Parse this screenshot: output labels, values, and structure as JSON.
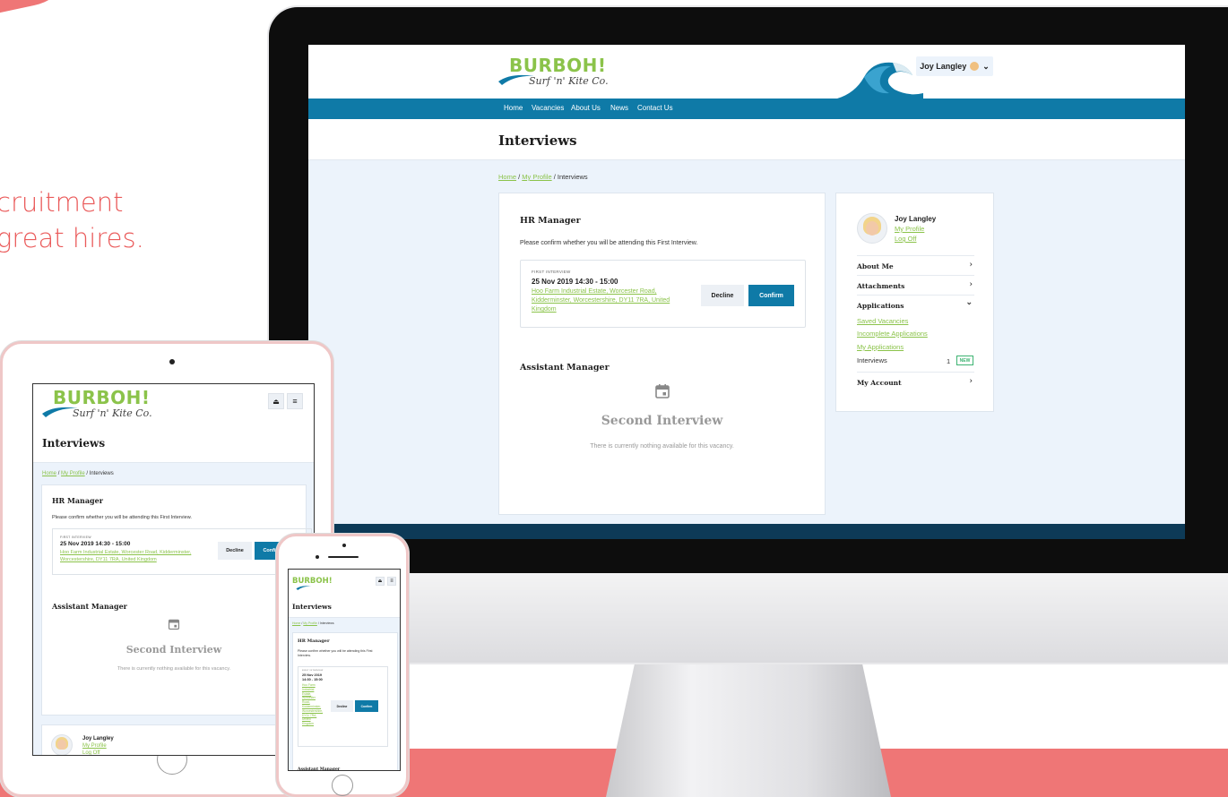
{
  "marketing": {
    "tagline_line1": "cruitment",
    "tagline_line2": "great hires.",
    "accent_color": "#ef7676"
  },
  "brand": {
    "logo_text": "BURBOH!",
    "logo_sub": "Surf 'n' Kite Co.",
    "primary_color": "#0f7aa7",
    "accent_color": "#8bc34a"
  },
  "header": {
    "user_name": "Joy Langley",
    "user_menu_icon": "chevron-down-icon"
  },
  "nav": [
    "Home",
    "Vacancies",
    "About Us",
    "News",
    "Contact Us"
  ],
  "page": {
    "title": "Interviews",
    "breadcrumb": {
      "home": "Home",
      "sep": "/",
      "profile": "My Profile",
      "current": "Interviews"
    }
  },
  "interviews": {
    "hr": {
      "title": "HR Manager",
      "prompt": "Please confirm whether you will be attending this First Interview.",
      "label": "FIRST INTERVIEW",
      "date": "25 Nov 2019 14:30 - 15:00",
      "address": "Hoo Farm Industrial Estate, Worcester Road, Kidderminster, Worcestershire, DY11 7RA, United Kingdom",
      "decline": "Decline",
      "confirm": "Confirm"
    },
    "assistant": {
      "title": "Assistant Manager",
      "empty_title": "Second Interview",
      "empty_text": "There is currently nothing available for this vacancy."
    }
  },
  "sidebar": {
    "name": "Joy Langley",
    "my_profile": "My Profile",
    "log_off": "Log Off",
    "about_me": "About Me",
    "attachments": "Attachments",
    "applications": "Applications",
    "saved_vacancies": "Saved Vacancies",
    "incomplete_applications": "Incomplete Applications",
    "my_applications": "My Applications",
    "interviews": "Interviews",
    "interviews_count": "1",
    "new_badge": "NEW",
    "my_account": "My Account",
    "chevron_right": "›",
    "chevron_down": "⌄"
  },
  "iphone": {
    "date_line1": "25 Nov 2019",
    "date_line2": "14:30 - 15:00",
    "addr_lines": [
      "Hoo Farm",
      "Industrial",
      "Estate,",
      "Worcester",
      "Road,",
      "Kidderminster,",
      "Worcestershire,",
      "DY11 7RA,",
      "United",
      "Kingdom"
    ],
    "prompt_line1": "Please confirm whether you will be attending this First",
    "prompt_line2": "Interview."
  },
  "ipad": {
    "address_line1": "Hoo Farm Industrial Estate, Worcester Road, Kidderminster,",
    "address_line2": "Worcestershire, DY11 7RA, United Kingdom",
    "confirm_partial": "Confirm"
  }
}
